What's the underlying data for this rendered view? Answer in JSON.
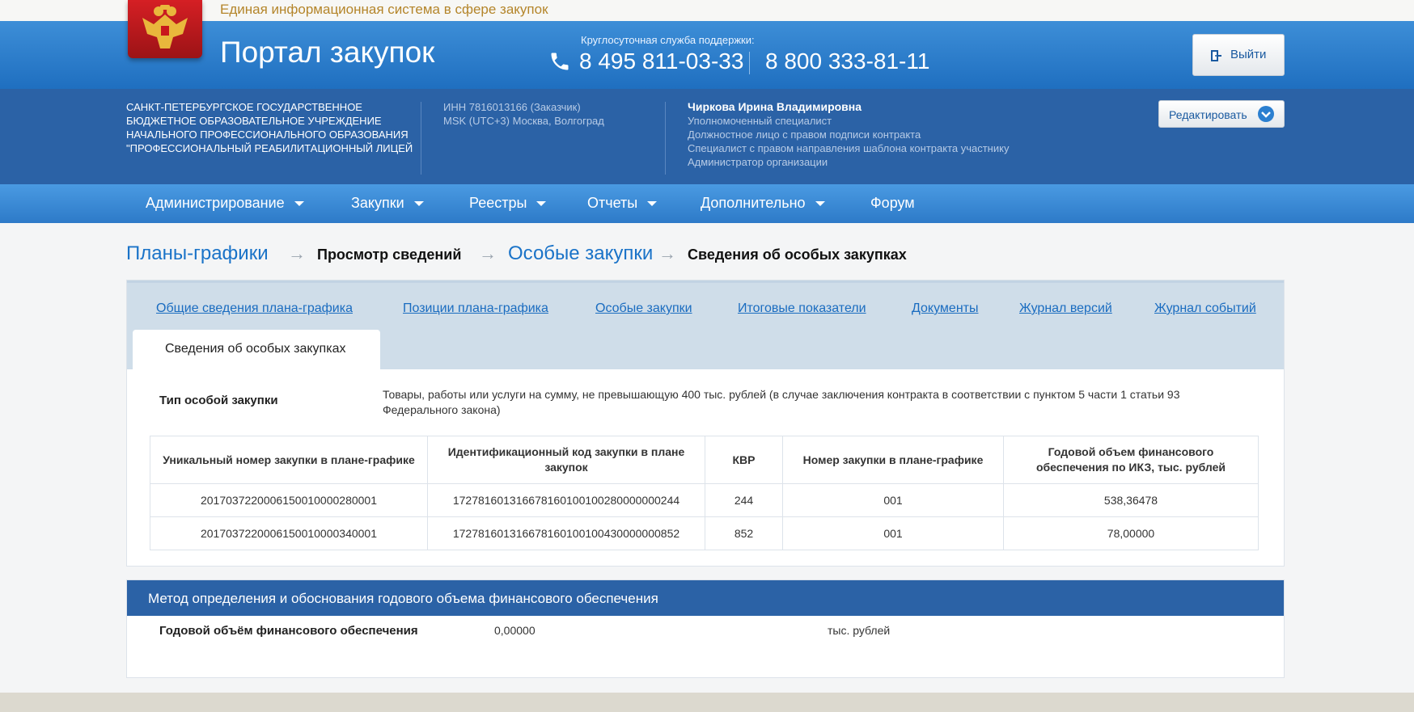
{
  "top": {
    "system_name": "Единая информационная система в сфере закупок"
  },
  "header": {
    "portal_title": "Портал закупок",
    "support_caption": "Круглосуточная служба поддержки:",
    "phone_1": "8 495 811-03-33",
    "phone_2": "8 800 333-81-11",
    "logout_label": "Выйти"
  },
  "org": {
    "name": "Санкт-Петербургское государственное бюджетное образовательное учреждение начального профессионального образования \"Профессиональный реабилитационный лицей",
    "inn": "ИНН 7816013166 (Заказчик)",
    "timezone": "MSK (UTC+3) Москва, Волгоград",
    "user_name": "Чиркова Ирина Владимировна",
    "roles": [
      "Уполномоченный специалист",
      "Должностное лицо с правом подписи контракта",
      "Специалист с правом направления шаблона контракта участнику",
      "Администратор организации"
    ],
    "edit_label": "Редактировать"
  },
  "nav": {
    "items": [
      {
        "label": "Администрирование"
      },
      {
        "label": "Закупки"
      },
      {
        "label": "Реестры"
      },
      {
        "label": "Отчеты"
      },
      {
        "label": "Дополнительно"
      },
      {
        "label": "Форум"
      }
    ]
  },
  "breadcrumb": {
    "items": [
      "Планы-графики",
      "Просмотр сведений",
      "Особые закупки",
      "Сведения об особых закупках"
    ]
  },
  "tabs": {
    "links": [
      "Общие сведения плана-графика",
      "Позиции плана-графика",
      "Особые закупки",
      "Итоговые показатели",
      "Документы",
      "Журнал версий",
      "Журнал событий"
    ],
    "active": "Сведения об особых закупках"
  },
  "special": {
    "type_label": "Тип особой закупки",
    "type_value": "Товары, работы или услуги на сумму, не превышающую 400 тыс. рублей (в случае заключения контракта в соответствии с пунктом 5 части 1 статьи 93 Федерального закона)",
    "table": {
      "headers": [
        "Уникальный номер закупки в плане-графике",
        "Идентификационный код закупки в плане закупок",
        "КВР",
        "Номер закупки в плане-графике",
        "Годовой объем финансового обеспечения по ИКЗ, тыс. рублей"
      ],
      "rows": [
        [
          "2017037220006150010000280001",
          "172781601316678160100100280000000244",
          "244",
          "001",
          "538,36478"
        ],
        [
          "2017037220006150010000340001",
          "172781601316678160100100430000000852",
          "852",
          "001",
          "78,00000"
        ]
      ]
    }
  },
  "method": {
    "header": "Метод определения и обоснования годового объема финансового обеспечения",
    "label": "Годовой объём финансового обеспечения",
    "value": "0,00000",
    "unit": "тыс. рублей"
  }
}
